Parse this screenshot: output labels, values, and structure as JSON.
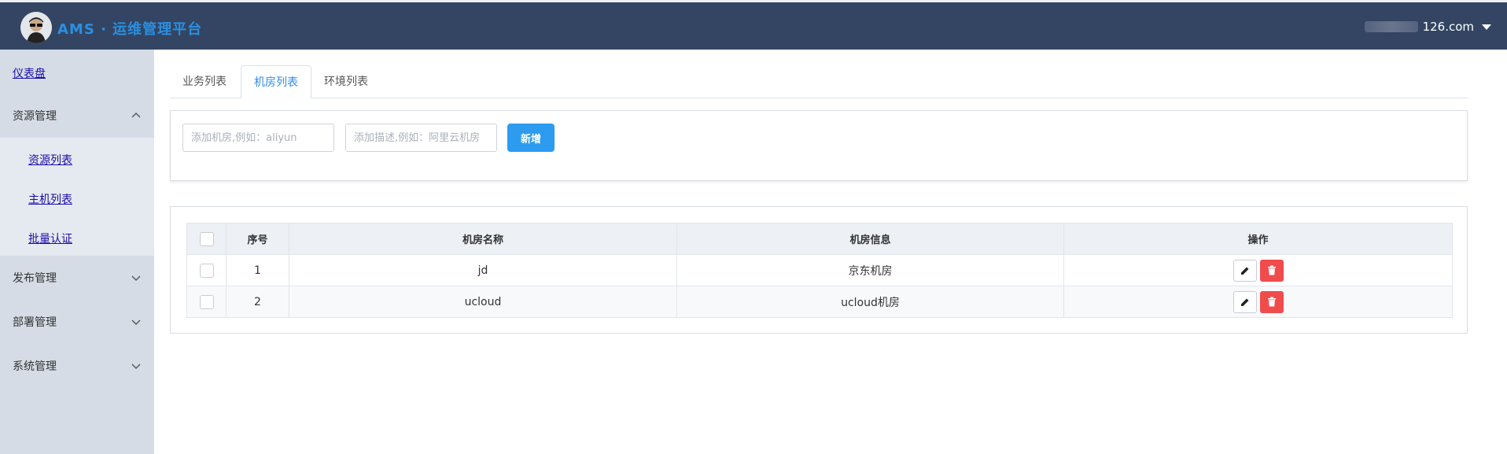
{
  "header": {
    "app_title": "AMS · 运维管理平台",
    "user_email": "126.com"
  },
  "sidebar": {
    "dashboard": "仪表盘",
    "groups": [
      {
        "label": "资源管理",
        "expanded": true,
        "items": [
          "资源列表",
          "主机列表",
          "批量认证"
        ]
      },
      {
        "label": "发布管理",
        "expanded": false
      },
      {
        "label": "部署管理",
        "expanded": false
      },
      {
        "label": "系统管理",
        "expanded": false
      }
    ]
  },
  "tabs": [
    "业务列表",
    "机房列表",
    "环境列表"
  ],
  "active_tab": "机房列表",
  "form": {
    "name_placeholder": "添加机房,例如：aliyun",
    "desc_placeholder": "添加描述,例如：阿里云机房",
    "add_label": "新增"
  },
  "table": {
    "headers": [
      "序号",
      "机房名称",
      "机房信息",
      "操作"
    ],
    "rows": [
      {
        "index": "1",
        "name": "jd",
        "info": "京东机房"
      },
      {
        "index": "2",
        "name": "ucloud",
        "info": "ucloud机房"
      }
    ]
  },
  "colors": {
    "header_bg": "#334563",
    "sidebar_bg": "#d5dce6",
    "accent": "#2d9bf0",
    "danger": "#f04c4c"
  },
  "icons": [
    "avatar",
    "caret-down-icon",
    "chevron-up-icon",
    "chevron-down-icon",
    "edit-icon",
    "trash-icon"
  ]
}
